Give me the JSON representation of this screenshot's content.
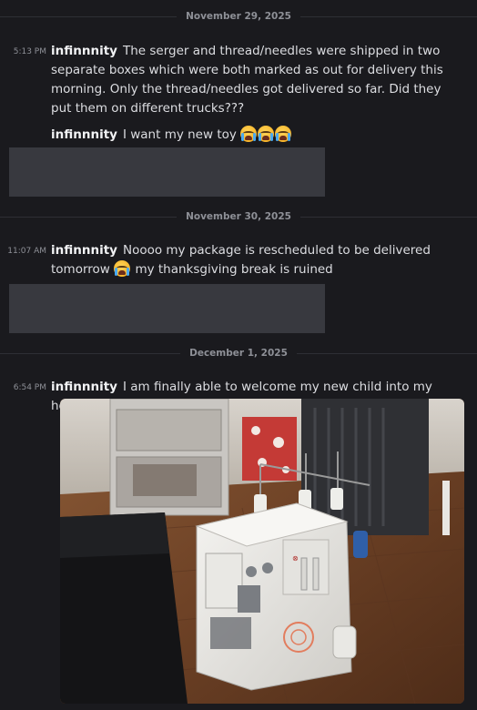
{
  "dividers": [
    {
      "date": "November 29, 2025"
    },
    {
      "date": "November 30, 2025"
    },
    {
      "date": "December 1, 2025"
    }
  ],
  "messages": [
    {
      "timestamp": "5:13 PM",
      "author": "infinnnity",
      "text": "The serger and thread/needles were shipped in two separate boxes which were both marked as out for delivery this morning. Only the thread/needles got delivered so far. Did they put them on different trucks???"
    },
    {
      "author": "infinnnity",
      "text": "I want my new toy",
      "emoji": [
        "loudly-crying-face",
        "loudly-crying-face",
        "loudly-crying-face"
      ]
    },
    {
      "timestamp": "11:07 AM",
      "author": "infinnnity",
      "text_before_emoji": "Noooo my package is rescheduled to be delivered tomorrow",
      "emoji": [
        "loudly-crying-face"
      ],
      "text_after_emoji": "my thanksgiving break is ruined"
    },
    {
      "timestamp": "6:54 PM",
      "author": "infinnnity",
      "text": "I am finally able to welcome my new child into my home",
      "attachment": "photo of a white serger sewing machine on a wooden floor"
    }
  ],
  "colors": {
    "background": "#1a1a1e",
    "text": "#dcdde1",
    "muted": "#8e9097",
    "redacted": "#38393f"
  }
}
